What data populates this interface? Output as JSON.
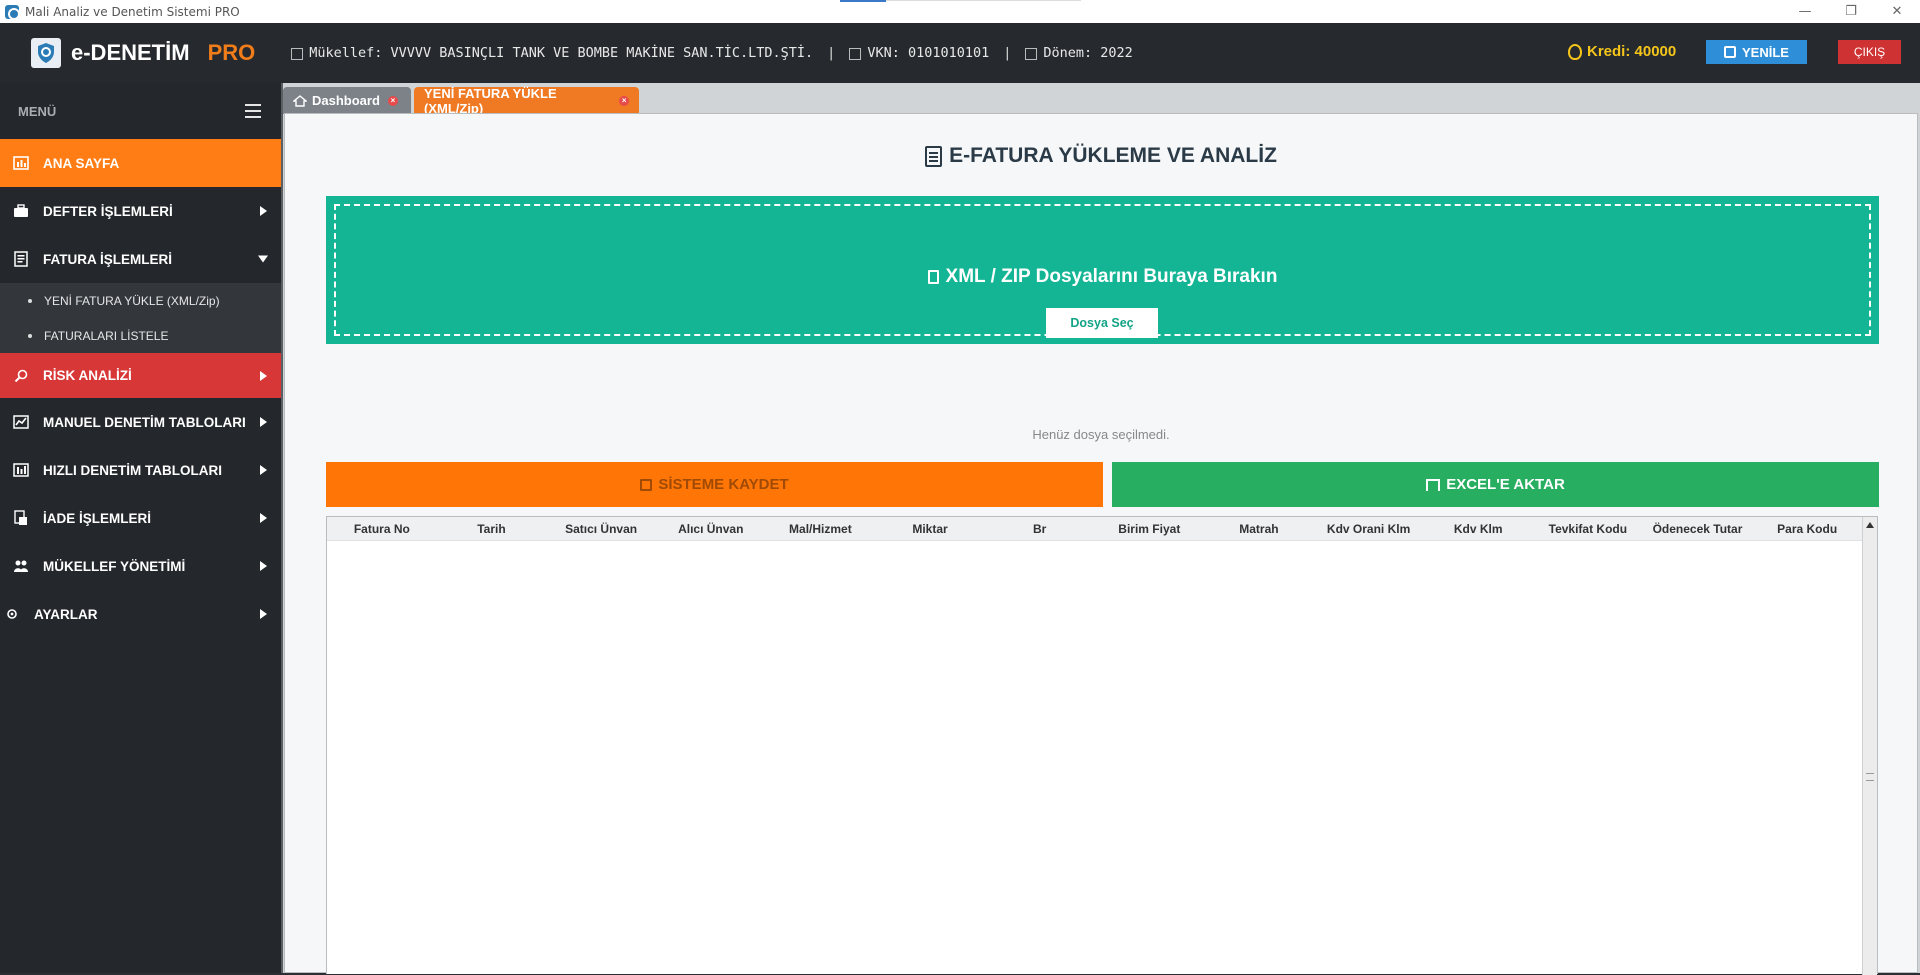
{
  "window": {
    "title": "Mali Analiz ve Denetim Sistemi PRO",
    "controls": [
      "—",
      "❐",
      "✕"
    ]
  },
  "header": {
    "logo_text": "e-DENETİM",
    "logo_pro": "PRO",
    "taxpayer": "Mükellef: VVVVV BASINÇLI TANK VE BOMBE MAKİNE SAN.TİC.LTD.ŞTİ.",
    "vkn": "VKN: 0101010101",
    "period": "Dönem: 2022",
    "separator": "|",
    "credit": "Kredi: 40000",
    "refresh_label": "YENİLE",
    "exit_label": "ÇIKIŞ"
  },
  "sidebar": {
    "menu_label": "MENÜ",
    "items": [
      {
        "label": "ANA SAYFA",
        "icon": "chart-icon"
      },
      {
        "label": "DEFTER İŞLEMLERİ",
        "icon": "briefcase-icon"
      },
      {
        "label": "FATURA İŞLEMLERİ",
        "icon": "invoice-icon"
      },
      {
        "label": "RİSK ANALİZİ",
        "icon": "search-icon"
      },
      {
        "label": "MANUEL DENETİM TABLOLARI",
        "icon": "line-chart-icon"
      },
      {
        "label": "HIZLI DENETİM TABLOLARI",
        "icon": "bar-chart-icon"
      },
      {
        "label": "İADE İŞLEMLERİ",
        "icon": "refund-icon"
      },
      {
        "label": "MÜKELLEF YÖNETİMİ",
        "icon": "users-icon"
      },
      {
        "label": "AYARLAR",
        "icon": "gear-icon"
      }
    ],
    "sub_items": [
      {
        "label": "YENİ FATURA YÜKLE (XML/Zip)"
      },
      {
        "label": "FATURALARI LİSTELE"
      }
    ]
  },
  "tabs": [
    {
      "label": "Dashboard"
    },
    {
      "label": "YENİ FATURA YÜKLE (XML/Zip)"
    }
  ],
  "page": {
    "title": "E-FATURA YÜKLEME VE ANALİZ",
    "drop_text": "XML / ZIP Dosyalarını Buraya Bırakın",
    "choose_file": "Dosya Seç",
    "no_file": "Henüz dosya seçilmedi.",
    "save_label": "SİSTEME KAYDET",
    "excel_label": "EXCEL'E AKTAR"
  },
  "table": {
    "columns": [
      "Fatura No",
      "Tarih",
      "Satıcı Ünvan",
      "Alıcı Ünvan",
      "Mal/Hizmet",
      "Miktar",
      "Br",
      "Birim Fiyat",
      "Matrah",
      "Kdv Orani Klm",
      "Kdv Klm",
      "Tevkifat Kodu",
      "Ödenecek Tutar",
      "Para Kodu"
    ],
    "rows": []
  },
  "colors": {
    "accent_orange": "#ff7d14",
    "risk_red": "#d83737",
    "dropzone_green": "#13b594",
    "excel_green": "#27ae60",
    "refresh_blue": "#2e8fd8",
    "credit_gold": "#f5c51a"
  }
}
